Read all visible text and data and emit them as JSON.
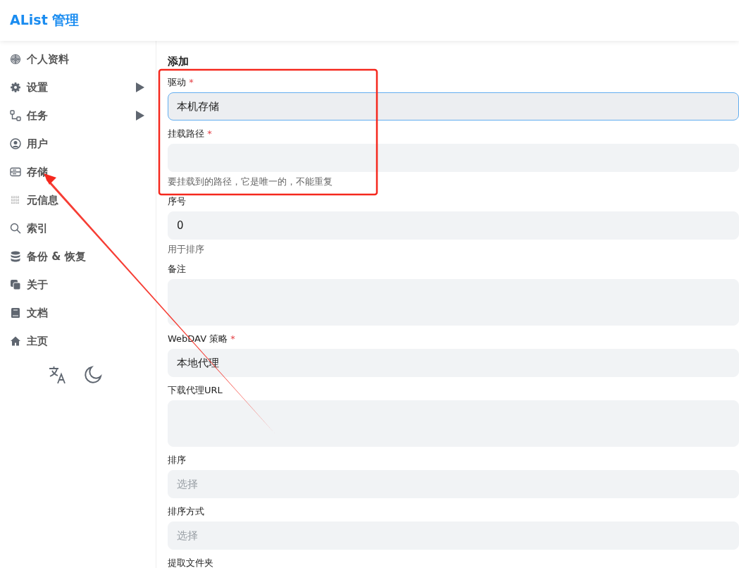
{
  "header": {
    "title": "AList 管理"
  },
  "sidebar": {
    "items": [
      {
        "label": "个人资料",
        "expandable": false
      },
      {
        "label": "设置",
        "expandable": true
      },
      {
        "label": "任务",
        "expandable": true
      },
      {
        "label": "用户",
        "expandable": false
      },
      {
        "label": "存储",
        "expandable": false
      },
      {
        "label": "元信息",
        "expandable": false
      },
      {
        "label": "索引",
        "expandable": false
      },
      {
        "label": "备份 & 恢复",
        "expandable": false
      },
      {
        "label": "关于",
        "expandable": false
      },
      {
        "label": "文档",
        "expandable": false
      },
      {
        "label": "主页",
        "expandable": false
      }
    ]
  },
  "form": {
    "title": "添加",
    "fields": [
      {
        "kind": "input",
        "label": "驱动",
        "required_mark": "*",
        "value": "本机存储",
        "focused": true
      },
      {
        "kind": "input",
        "label": "挂载路径",
        "required_mark": "*",
        "help": "要挂载到的路径，它是唯一的，不能重复",
        "focused": false
      },
      {
        "kind": "input",
        "label": "序号",
        "value": "0",
        "help": "用于排序",
        "focused": false
      },
      {
        "kind": "textarea",
        "label": "备注",
        "focused": false
      },
      {
        "kind": "input",
        "label": "WebDAV 策略",
        "required_mark": "*",
        "value": "本地代理",
        "focused": false
      },
      {
        "kind": "textarea",
        "label": "下载代理URL",
        "focused": false
      },
      {
        "kind": "input",
        "label": "排序",
        "placeholder": "选择",
        "focused": false
      },
      {
        "kind": "input",
        "label": "排序方式",
        "placeholder": "选择",
        "focused": false
      },
      {
        "kind": "label",
        "label": "提取文件夹"
      }
    ]
  }
}
